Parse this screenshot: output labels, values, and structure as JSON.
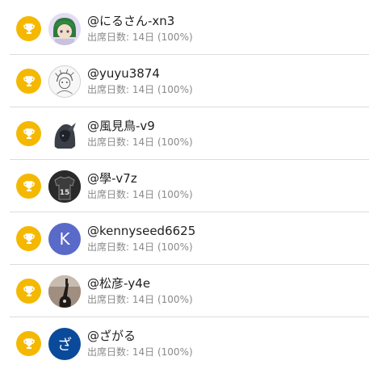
{
  "accent_colors": {
    "trophy": "#f5b800",
    "avatar_k": "#5a6ac8",
    "avatar_za": "#0a4a9a"
  },
  "stat_label": "出席日数:",
  "users": [
    {
      "name": "@にるさん-xn3",
      "days": "14日",
      "percent": "(100%)",
      "avatar": "anime-girl-avatar"
    },
    {
      "name": "@yuyu3874",
      "days": "14日",
      "percent": "(100%)",
      "avatar": "sketch-avatar"
    },
    {
      "name": "@風見鳥-v9",
      "days": "14日",
      "percent": "(100%)",
      "avatar": "hooded-figure-avatar"
    },
    {
      "name": "@學-v7z",
      "days": "14日",
      "percent": "(100%)",
      "avatar": "jersey-15-avatar",
      "avatar_text": "15"
    },
    {
      "name": "@kennyseed6625",
      "days": "14日",
      "percent": "(100%)",
      "avatar": "letter-avatar",
      "avatar_text": "K"
    },
    {
      "name": "@松彦-y4e",
      "days": "14日",
      "percent": "(100%)",
      "avatar": "guitar-photo-avatar"
    },
    {
      "name": "@ざがる",
      "days": "14日",
      "percent": "(100%)",
      "avatar": "letter-avatar",
      "avatar_text": "ざ"
    }
  ]
}
